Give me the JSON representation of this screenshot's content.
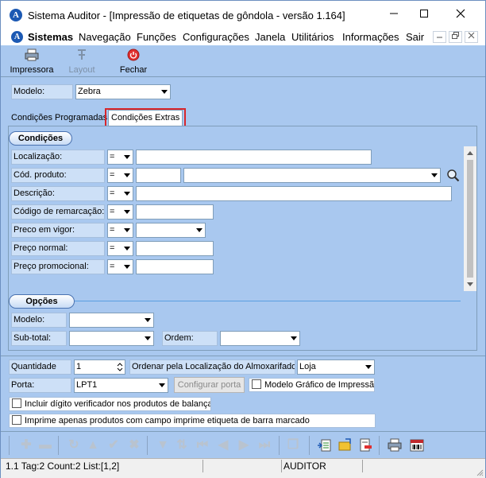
{
  "window": {
    "title": "Sistema Auditor - [Impressão de etiquetas de gôndola - versão 1.164]",
    "logo_letter": "A"
  },
  "menu": {
    "items": [
      "Sistemas",
      "Navegação",
      "Funções",
      "Configurações",
      "Janela",
      "Utilitários",
      "Informações",
      "Sair"
    ]
  },
  "toolbar": {
    "printer_label": "Impressora",
    "layout_label": "Layout",
    "close_label": "Fechar"
  },
  "modelo": {
    "label": "Modelo:",
    "value": "Zebra"
  },
  "tabs": {
    "programmed": "Condições Programadas",
    "extras": "Condições Extras"
  },
  "conditions": {
    "group_title": "Condições",
    "rows": [
      {
        "label": "Localização:",
        "op": "="
      },
      {
        "label": "Cód. produto:",
        "op": "="
      },
      {
        "label": "Descrição:",
        "op": "="
      },
      {
        "label": "Código de remarcação:",
        "op": "="
      },
      {
        "label": "Preco em vigor:",
        "op": "="
      },
      {
        "label": "Preço normal:",
        "op": "="
      },
      {
        "label": "Preço promocional:",
        "op": "="
      }
    ]
  },
  "options": {
    "group_title": "Opções",
    "modelo_label": "Modelo:",
    "subtotal_label": "Sub-total:",
    "ordem_label": "Ordem:"
  },
  "bottom": {
    "quantidade_label": "Quantidade",
    "quantidade_value": "1",
    "ordenar_label": "Ordenar pela Localização do Almoxarifado:",
    "ordenar_value": "Loja",
    "porta_label": "Porta:",
    "porta_value": "LPT1",
    "config_porta_button": "Configurar porta",
    "modelo_grafico_label": "Modelo Gráfico de Impressão",
    "incluir_digito_label": "Incluir dígito verificador nos produtos de balança",
    "imprime_apenas_label": "Imprime apenas produtos com campo imprime etiqueta de barra marcado"
  },
  "status": {
    "info": "1.1 Tag:2 Count:2 List:[1,2]",
    "user": "AUDITOR"
  },
  "colors": {
    "background": "#a9c8ef",
    "highlight_border": "#d8262b",
    "accent": "#1c59b3"
  }
}
